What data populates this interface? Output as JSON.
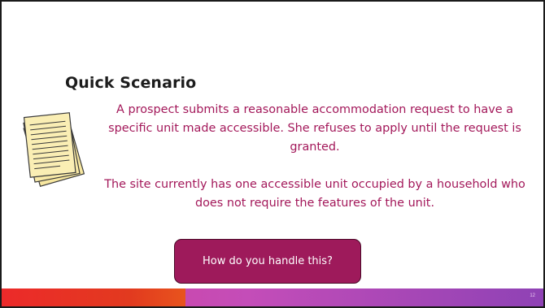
{
  "slide": {
    "title": "Quick Scenario",
    "paragraph_1": "A prospect submits a reasonable accommodation request to have a specific unit made accessible. She refuses to apply until the request is granted.",
    "paragraph_2": "The site currently has one accessible unit occupied by a household who does not require the features of the unit.",
    "button_label": "How do you handle this?",
    "page_number": "12",
    "icon": "documents-icon"
  },
  "colors": {
    "accent_text": "#a3185a",
    "button_fill": "#9e1a5b",
    "footer_left": "#ec2a2a",
    "footer_right": "#c44db8"
  }
}
